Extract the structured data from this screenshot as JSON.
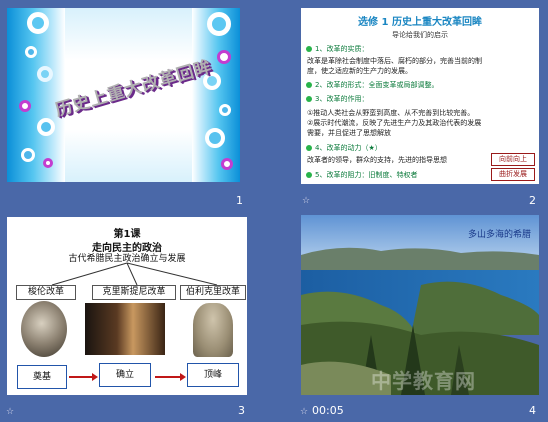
{
  "slide1": {
    "title": "历史上重大改革回眸",
    "number": "1"
  },
  "slide2": {
    "title": "选修 1 历史上重大改革回眸",
    "subtitle": "导论给我们的启示",
    "lines": [
      "1、改革的实质：",
      "改革是革除社会制度中落后、腐朽的部分，完善当前的制",
      "度，使之适应新的生产力的发展。",
      "2、改革的形式：全面变革或局部调整。",
      "3、改革的作用：",
      "①推动人类社会从野蛮到高度、从不完善到比较完善。",
      "②展示时代潮流，反映了先进生产力及其政治代表的发展",
      "需要，并且促进了思想解放",
      "4、改革的动力（★）",
      "改革者的领导，群众的支持，先进的指导思想",
      "5、改革的阻力：旧制度、特权者"
    ],
    "box1": "向前向上",
    "box2": "曲折发展",
    "number": "2",
    "foot_mark": "☆"
  },
  "slide3": {
    "heading": "第1课",
    "subtitle1": "走向民主的政治",
    "subtitle2": "古代希腊民主政治确立与发展",
    "reformers": [
      "梭伦改革",
      "克里斯提尼改革",
      "伯利克里改革"
    ],
    "stages": [
      "奠基",
      "确立",
      "顶峰"
    ],
    "number": "3",
    "foot_mark": "☆"
  },
  "slide4": {
    "caption": "多山多海的希腊",
    "time": "00:05",
    "number": "4",
    "foot_mark": "☆",
    "watermark": "中学教育网"
  },
  "colors": {
    "background": "#4a68a8",
    "accent_blue": "#1a86c2",
    "bullet_green": "#29b34a",
    "box_red": "#9a1a1a"
  }
}
